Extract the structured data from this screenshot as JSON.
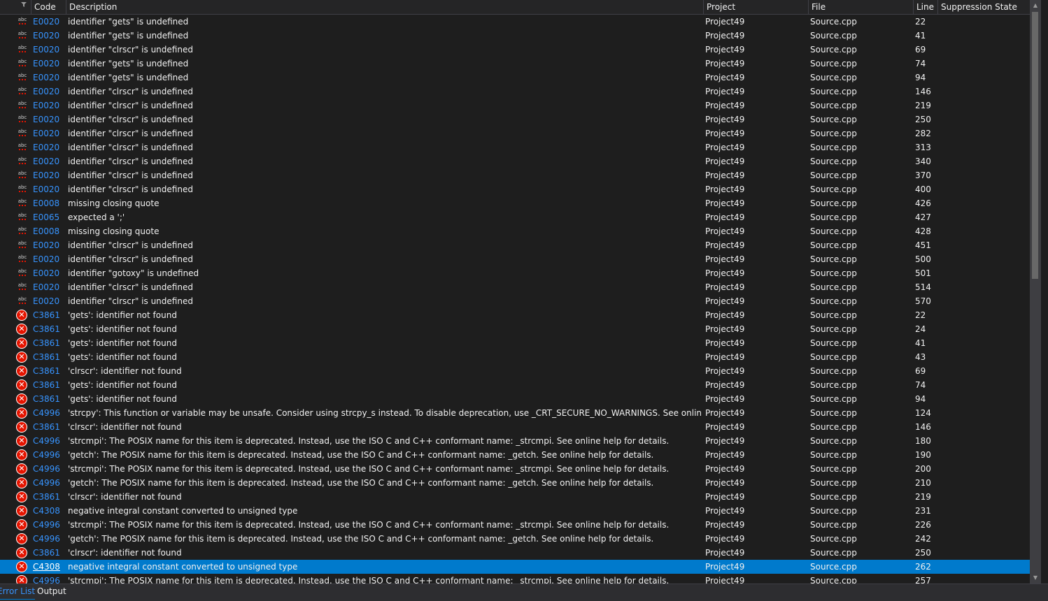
{
  "columns": {
    "code": "Code",
    "description": "Description",
    "project": "Project",
    "file": "File",
    "line": "Line",
    "suppression": "Suppression State"
  },
  "icons": {
    "intellisense": "abc",
    "error": "✕"
  },
  "colors": {
    "accent": "#007acc",
    "link": "#3794ff",
    "error": "#e51400"
  },
  "rows": [
    {
      "icon": "abc",
      "code": "E0020",
      "desc": "identifier \"gets\" is undefined",
      "project": "Project49",
      "file": "Source.cpp",
      "line": "22"
    },
    {
      "icon": "abc",
      "code": "E0020",
      "desc": "identifier \"gets\" is undefined",
      "project": "Project49",
      "file": "Source.cpp",
      "line": "41"
    },
    {
      "icon": "abc",
      "code": "E0020",
      "desc": "identifier \"clrscr\" is undefined",
      "project": "Project49",
      "file": "Source.cpp",
      "line": "69"
    },
    {
      "icon": "abc",
      "code": "E0020",
      "desc": "identifier \"gets\" is undefined",
      "project": "Project49",
      "file": "Source.cpp",
      "line": "74"
    },
    {
      "icon": "abc",
      "code": "E0020",
      "desc": "identifier \"gets\" is undefined",
      "project": "Project49",
      "file": "Source.cpp",
      "line": "94"
    },
    {
      "icon": "abc",
      "code": "E0020",
      "desc": "identifier \"clrscr\" is undefined",
      "project": "Project49",
      "file": "Source.cpp",
      "line": "146"
    },
    {
      "icon": "abc",
      "code": "E0020",
      "desc": "identifier \"clrscr\" is undefined",
      "project": "Project49",
      "file": "Source.cpp",
      "line": "219"
    },
    {
      "icon": "abc",
      "code": "E0020",
      "desc": "identifier \"clrscr\" is undefined",
      "project": "Project49",
      "file": "Source.cpp",
      "line": "250"
    },
    {
      "icon": "abc",
      "code": "E0020",
      "desc": "identifier \"clrscr\" is undefined",
      "project": "Project49",
      "file": "Source.cpp",
      "line": "282"
    },
    {
      "icon": "abc",
      "code": "E0020",
      "desc": "identifier \"clrscr\" is undefined",
      "project": "Project49",
      "file": "Source.cpp",
      "line": "313"
    },
    {
      "icon": "abc",
      "code": "E0020",
      "desc": "identifier \"clrscr\" is undefined",
      "project": "Project49",
      "file": "Source.cpp",
      "line": "340"
    },
    {
      "icon": "abc",
      "code": "E0020",
      "desc": "identifier \"clrscr\" is undefined",
      "project": "Project49",
      "file": "Source.cpp",
      "line": "370"
    },
    {
      "icon": "abc",
      "code": "E0020",
      "desc": "identifier \"clrscr\" is undefined",
      "project": "Project49",
      "file": "Source.cpp",
      "line": "400"
    },
    {
      "icon": "abc",
      "code": "E0008",
      "desc": "missing closing quote",
      "project": "Project49",
      "file": "Source.cpp",
      "line": "426"
    },
    {
      "icon": "abc",
      "code": "E0065",
      "desc": "expected a ';'",
      "project": "Project49",
      "file": "Source.cpp",
      "line": "427"
    },
    {
      "icon": "abc",
      "code": "E0008",
      "desc": "missing closing quote",
      "project": "Project49",
      "file": "Source.cpp",
      "line": "428"
    },
    {
      "icon": "abc",
      "code": "E0020",
      "desc": "identifier \"clrscr\" is undefined",
      "project": "Project49",
      "file": "Source.cpp",
      "line": "451"
    },
    {
      "icon": "abc",
      "code": "E0020",
      "desc": "identifier \"clrscr\" is undefined",
      "project": "Project49",
      "file": "Source.cpp",
      "line": "500"
    },
    {
      "icon": "abc",
      "code": "E0020",
      "desc": "identifier \"gotoxy\" is undefined",
      "project": "Project49",
      "file": "Source.cpp",
      "line": "501"
    },
    {
      "icon": "abc",
      "code": "E0020",
      "desc": "identifier \"clrscr\" is undefined",
      "project": "Project49",
      "file": "Source.cpp",
      "line": "514"
    },
    {
      "icon": "abc",
      "code": "E0020",
      "desc": "identifier \"clrscr\" is undefined",
      "project": "Project49",
      "file": "Source.cpp",
      "line": "570"
    },
    {
      "icon": "error",
      "code": "C3861",
      "desc": "'gets': identifier not found",
      "project": "Project49",
      "file": "Source.cpp",
      "line": "22"
    },
    {
      "icon": "error",
      "code": "C3861",
      "desc": "'gets': identifier not found",
      "project": "Project49",
      "file": "Source.cpp",
      "line": "24"
    },
    {
      "icon": "error",
      "code": "C3861",
      "desc": "'gets': identifier not found",
      "project": "Project49",
      "file": "Source.cpp",
      "line": "41"
    },
    {
      "icon": "error",
      "code": "C3861",
      "desc": "'gets': identifier not found",
      "project": "Project49",
      "file": "Source.cpp",
      "line": "43"
    },
    {
      "icon": "error",
      "code": "C3861",
      "desc": "'clrscr': identifier not found",
      "project": "Project49",
      "file": "Source.cpp",
      "line": "69"
    },
    {
      "icon": "error",
      "code": "C3861",
      "desc": "'gets': identifier not found",
      "project": "Project49",
      "file": "Source.cpp",
      "line": "74"
    },
    {
      "icon": "error",
      "code": "C3861",
      "desc": "'gets': identifier not found",
      "project": "Project49",
      "file": "Source.cpp",
      "line": "94"
    },
    {
      "icon": "error",
      "code": "C4996",
      "desc": "'strcpy': This function or variable may be unsafe. Consider using strcpy_s instead. To disable deprecation, use _CRT_SECURE_NO_WARNINGS. See online help for details.",
      "project": "Project49",
      "file": "Source.cpp",
      "line": "124"
    },
    {
      "icon": "error",
      "code": "C3861",
      "desc": "'clrscr': identifier not found",
      "project": "Project49",
      "file": "Source.cpp",
      "line": "146"
    },
    {
      "icon": "error",
      "code": "C4996",
      "desc": "'strcmpi': The POSIX name for this item is deprecated. Instead, use the ISO C and C++ conformant name: _strcmpi. See online help for details.",
      "project": "Project49",
      "file": "Source.cpp",
      "line": "180"
    },
    {
      "icon": "error",
      "code": "C4996",
      "desc": "'getch': The POSIX name for this item is deprecated. Instead, use the ISO C and C++ conformant name: _getch. See online help for details.",
      "project": "Project49",
      "file": "Source.cpp",
      "line": "190"
    },
    {
      "icon": "error",
      "code": "C4996",
      "desc": "'strcmpi': The POSIX name for this item is deprecated. Instead, use the ISO C and C++ conformant name: _strcmpi. See online help for details.",
      "project": "Project49",
      "file": "Source.cpp",
      "line": "200"
    },
    {
      "icon": "error",
      "code": "C4996",
      "desc": "'getch': The POSIX name for this item is deprecated. Instead, use the ISO C and C++ conformant name: _getch. See online help for details.",
      "project": "Project49",
      "file": "Source.cpp",
      "line": "210"
    },
    {
      "icon": "error",
      "code": "C3861",
      "desc": "'clrscr': identifier not found",
      "project": "Project49",
      "file": "Source.cpp",
      "line": "219"
    },
    {
      "icon": "error",
      "code": "C4308",
      "desc": "negative integral constant converted to unsigned type",
      "project": "Project49",
      "file": "Source.cpp",
      "line": "231"
    },
    {
      "icon": "error",
      "code": "C4996",
      "desc": "'strcmpi': The POSIX name for this item is deprecated. Instead, use the ISO C and C++ conformant name: _strcmpi. See online help for details.",
      "project": "Project49",
      "file": "Source.cpp",
      "line": "226"
    },
    {
      "icon": "error",
      "code": "C4996",
      "desc": "'getch': The POSIX name for this item is deprecated. Instead, use the ISO C and C++ conformant name: _getch. See online help for details.",
      "project": "Project49",
      "file": "Source.cpp",
      "line": "242"
    },
    {
      "icon": "error",
      "code": "C3861",
      "desc": "'clrscr': identifier not found",
      "project": "Project49",
      "file": "Source.cpp",
      "line": "250"
    },
    {
      "icon": "error",
      "code": "C4308",
      "desc": "negative integral constant converted to unsigned type",
      "project": "Project49",
      "file": "Source.cpp",
      "line": "262",
      "selected": true
    },
    {
      "icon": "error",
      "code": "C4996",
      "desc": "'strcmpi': The POSIX name for this item is deprecated. Instead, use the ISO C and C++ conformant name: _strcmpi. See online help for details.",
      "project": "Project49",
      "file": "Source.cpp",
      "line": "257"
    }
  ],
  "tabs": {
    "error_list": "Error List",
    "output": "Output"
  }
}
